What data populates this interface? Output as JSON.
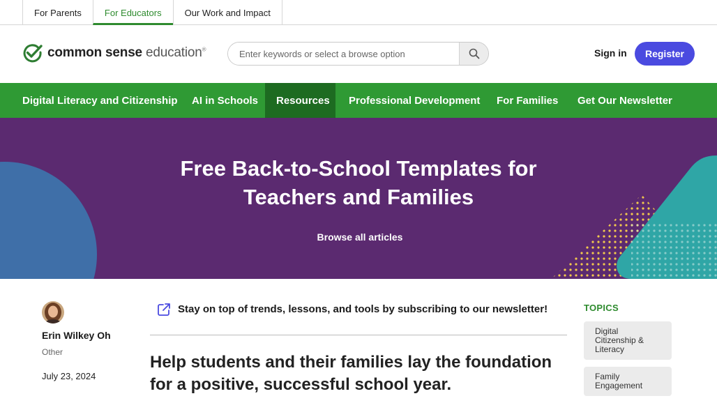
{
  "audience_tabs": [
    {
      "label": "For Parents"
    },
    {
      "label": "For Educators"
    },
    {
      "label": "Our Work and Impact"
    }
  ],
  "logo": {
    "bold": "common sense",
    "light": "education",
    "mark": "®"
  },
  "search": {
    "placeholder": "Enter keywords or select a browse option",
    "value": ""
  },
  "auth": {
    "signin": "Sign in",
    "register": "Register"
  },
  "nav": [
    {
      "label": "Digital Literacy and Citizenship"
    },
    {
      "label": "AI in Schools"
    },
    {
      "label": "Resources"
    },
    {
      "label": "Professional Development"
    },
    {
      "label": "For Families"
    },
    {
      "label": "Get Our Newsletter"
    }
  ],
  "hero": {
    "title_line1": "Free Back-to-School Templates for",
    "title_line2": "Teachers and Families",
    "browse": "Browse all articles"
  },
  "author": {
    "name": "Erin Wilkey Oh",
    "role": "Other",
    "date": "July 23, 2024"
  },
  "newsletter": {
    "text": "Stay on top of trends, lessons, and tools by subscribing to our newsletter!"
  },
  "article": {
    "lead_line1": "Help students and their families lay the foundation",
    "lead_line2": "for a positive, successful school year."
  },
  "topics": {
    "label": "TOPICS",
    "items": [
      {
        "line1": "Digital",
        "line2": "Citizenship &",
        "line3": "Literacy"
      },
      {
        "line1": "Family",
        "line2": "Engagement"
      }
    ]
  },
  "colors": {
    "brand_green": "#2f9a34",
    "nav_active": "#1d6b21",
    "register": "#4a4ae0",
    "hero": "#5b2a70"
  },
  "active_nav": "Resources",
  "active_audience": "For Educators"
}
